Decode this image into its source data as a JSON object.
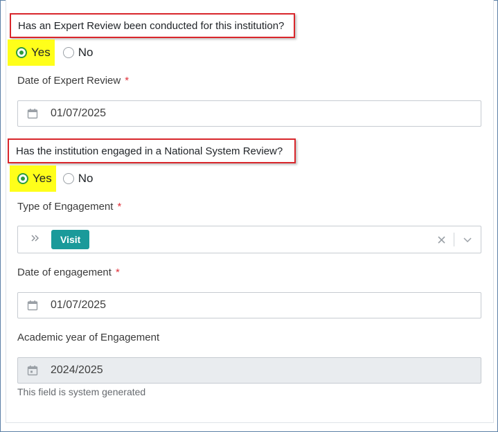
{
  "expert_review": {
    "question": "Has an Expert Review been conducted for this institution?",
    "options": {
      "yes": "Yes",
      "no": "No"
    },
    "selected": "Yes",
    "date_label": "Date of Expert Review",
    "date_required_mark": "*",
    "date_value": "01/07/2025"
  },
  "national_review": {
    "question": "Has the institution engaged in a National System Review?",
    "options": {
      "yes": "Yes",
      "no": "No"
    },
    "selected": "Yes",
    "type_label": "Type of Engagement",
    "type_required_mark": "*",
    "type_selected_tags": [
      "Visit"
    ],
    "date_label": "Date of engagement",
    "date_required_mark": "*",
    "date_value": "01/07/2025",
    "academic_year_label": "Academic year of Engagement",
    "academic_year_value": "2024/2025",
    "academic_year_help": "This field is system generated"
  },
  "icons": {
    "calendar": "calendar-icon",
    "chevrons": "double-chevron-right-icon",
    "clear": "close-icon",
    "dropdown": "chevron-down-icon"
  },
  "colors": {
    "highlight": "#ffff1a",
    "annotation_box": "#d9262b",
    "radio_checked": "#2e9b3e",
    "tag": "#1a9a9a",
    "required": "#e0313a"
  }
}
